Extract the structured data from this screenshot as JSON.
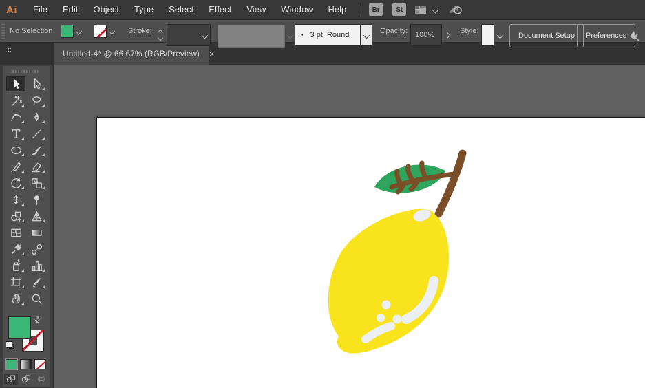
{
  "menubar": {
    "logo": "Ai",
    "items": [
      "File",
      "Edit",
      "Object",
      "Type",
      "Select",
      "Effect",
      "View",
      "Window",
      "Help"
    ],
    "bridge_label": "Br",
    "stock_label": "St"
  },
  "control_bar": {
    "selection_status": "No Selection",
    "stroke_label": "Stroke:",
    "brush_bullet": "•",
    "brush_name": "3 pt. Round",
    "opacity_label": "Opacity:",
    "opacity_value": "100%",
    "style_label": "Style:",
    "document_setup_label": "Document Setup",
    "preferences_label": "Preferences"
  },
  "tab_bar": {
    "collapse_glyph": "«",
    "document_title": "Untitled-4* @ 66.67% (RGB/Preview)",
    "close_glyph": "×"
  },
  "toolbar": {
    "swap_glyph": "⇄",
    "tools": [
      {
        "name": "selection",
        "icon": "selection",
        "active": true,
        "flyout": false
      },
      {
        "name": "direct-selection",
        "icon": "direct-selection",
        "active": false,
        "flyout": true
      },
      {
        "name": "magic-wand",
        "icon": "magic-wand",
        "active": false,
        "flyout": true
      },
      {
        "name": "lasso",
        "icon": "lasso",
        "active": false,
        "flyout": true
      },
      {
        "name": "curvature",
        "icon": "curvature",
        "active": false,
        "flyout": true
      },
      {
        "name": "pen",
        "icon": "pen",
        "active": false,
        "flyout": true
      },
      {
        "name": "type",
        "icon": "type",
        "active": false,
        "flyout": true
      },
      {
        "name": "line-segment",
        "icon": "line-segment",
        "active": false,
        "flyout": true
      },
      {
        "name": "ellipse",
        "icon": "ellipse",
        "active": false,
        "flyout": true
      },
      {
        "name": "paintbrush",
        "icon": "paintbrush",
        "active": false,
        "flyout": true
      },
      {
        "name": "shaper",
        "icon": "shaper",
        "active": false,
        "flyout": true
      },
      {
        "name": "eraser",
        "icon": "eraser",
        "active": false,
        "flyout": true
      },
      {
        "name": "rotate",
        "icon": "rotate",
        "active": false,
        "flyout": true
      },
      {
        "name": "scale",
        "icon": "scale",
        "active": false,
        "flyout": true
      },
      {
        "name": "width",
        "icon": "width",
        "active": false,
        "flyout": true
      },
      {
        "name": "puppet-warp",
        "icon": "puppet-warp",
        "active": false,
        "flyout": false
      },
      {
        "name": "shape-builder",
        "icon": "shape-builder",
        "active": false,
        "flyout": true
      },
      {
        "name": "perspective-grid",
        "icon": "perspective-grid",
        "active": false,
        "flyout": true
      },
      {
        "name": "mesh",
        "icon": "mesh",
        "active": false,
        "flyout": false
      },
      {
        "name": "gradient",
        "icon": "gradient",
        "active": false,
        "flyout": false
      },
      {
        "name": "eyedropper",
        "icon": "eyedropper",
        "active": false,
        "flyout": true
      },
      {
        "name": "blend",
        "icon": "blend",
        "active": false,
        "flyout": false
      },
      {
        "name": "symbol-sprayer",
        "icon": "symbol-sprayer",
        "active": false,
        "flyout": true
      },
      {
        "name": "column-graph",
        "icon": "column-graph",
        "active": false,
        "flyout": true
      },
      {
        "name": "artboard",
        "icon": "artboard",
        "active": false,
        "flyout": true
      },
      {
        "name": "slice",
        "icon": "slice",
        "active": false,
        "flyout": true
      },
      {
        "name": "hand",
        "icon": "hand",
        "active": false,
        "flyout": true
      },
      {
        "name": "zoom",
        "icon": "zoom",
        "active": false,
        "flyout": false
      }
    ]
  },
  "colors": {
    "accent_fill": "#3BB878",
    "lemon_yellow": "#F9E31C",
    "leaf_green": "#2EA45C",
    "stem_brown": "#7A4E26",
    "highlight": "#ECEFF3",
    "artboard_white": "#FFFFFF",
    "pasteboard_gray": "#616161"
  }
}
